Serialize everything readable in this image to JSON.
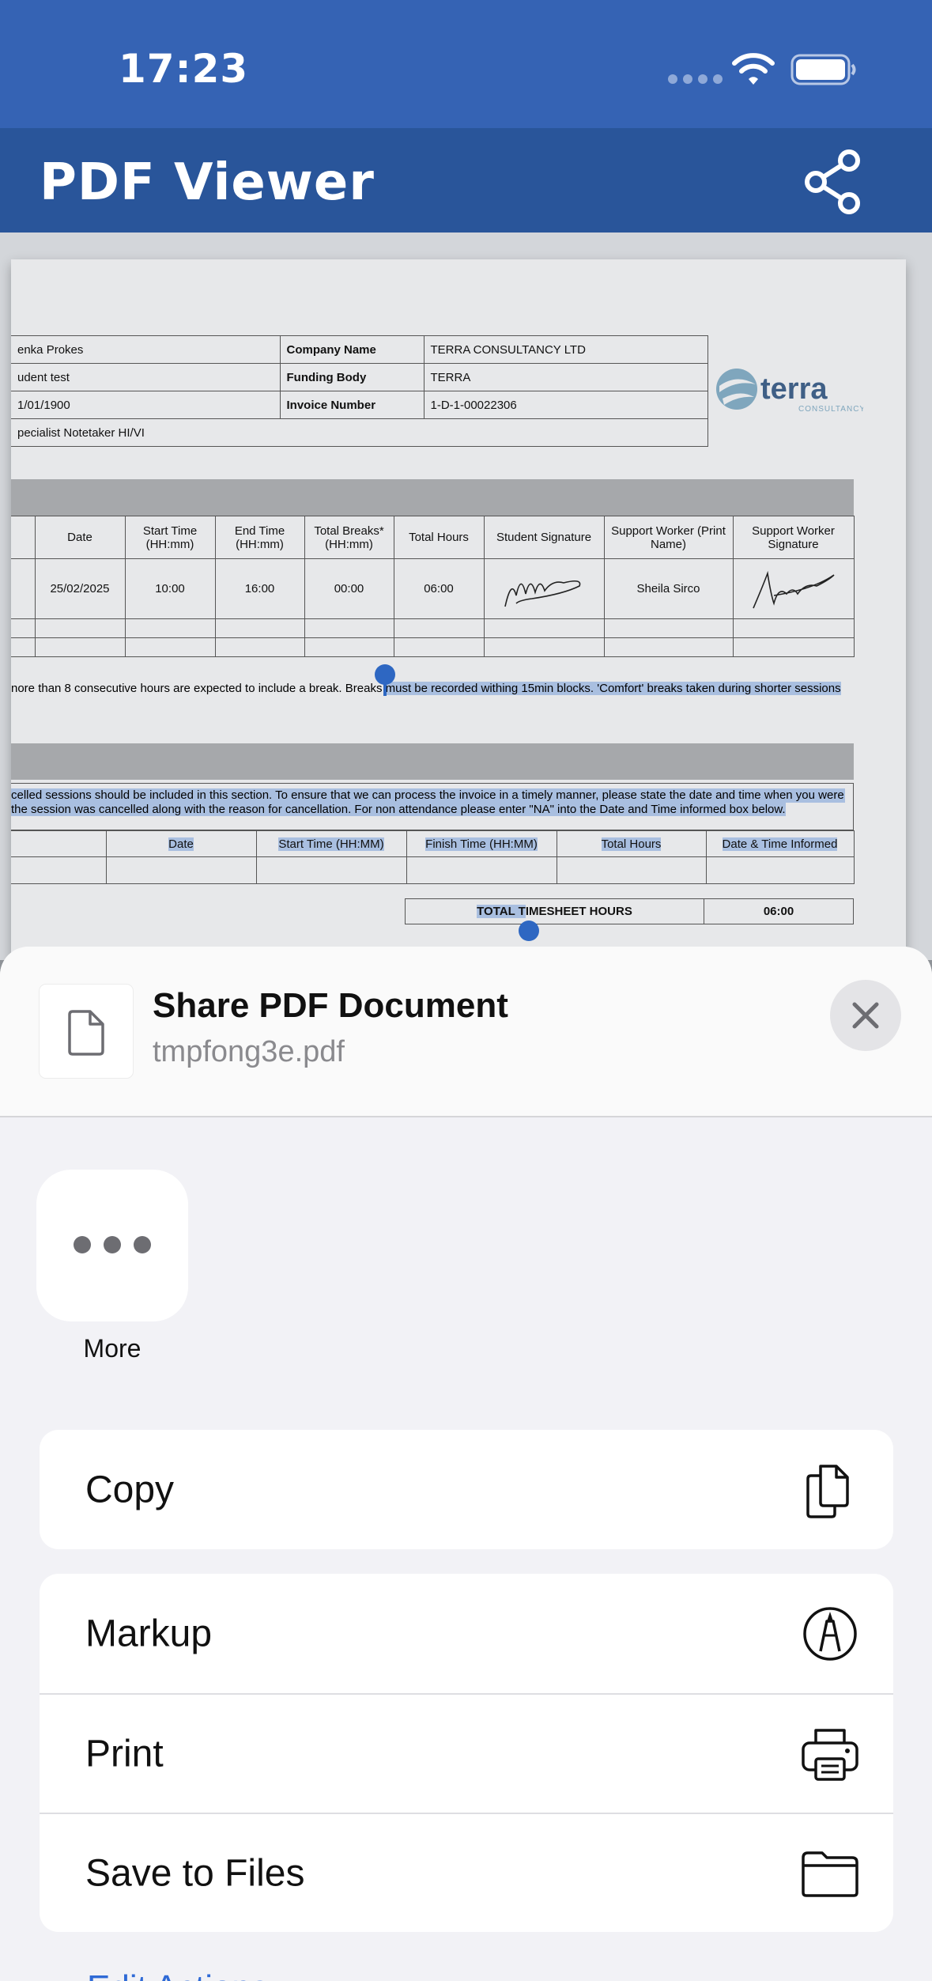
{
  "status_bar": {
    "time": "17:23",
    "wifi_icon": "wifi-icon",
    "battery_icon": "battery-icon"
  },
  "app_bar": {
    "title": "PDF Viewer",
    "share_icon": "share-icon"
  },
  "pdf": {
    "info_rows": [
      {
        "value": "enka Prokes",
        "label": "Company Name",
        "right": "TERRA CONSULTANCY LTD"
      },
      {
        "value": "udent test",
        "label": "Funding Body",
        "right": "TERRA"
      },
      {
        "value": "1/01/1900",
        "label": "Invoice Number",
        "right": "1-D-1-00022306"
      },
      {
        "value": "pecialist Notetaker HI/VI",
        "label": "",
        "right": ""
      }
    ],
    "logo_text": "terra",
    "logo_subtext": "CONSULTANCY",
    "session_headers": [
      "",
      "Date",
      "Start Time (HH:mm)",
      "End Time (HH:mm)",
      "Total Breaks* (HH:mm)",
      "Total Hours",
      "Student Signature",
      "Support Worker (Print Name)",
      "Support Worker Signature"
    ],
    "session_row": {
      "date": "25/02/2025",
      "start": "10:00",
      "end": "16:00",
      "breaks": "00:00",
      "hours": "06:00",
      "worker_name": "Sheila Sirco"
    },
    "breaks_note_plain": "nore than 8 consecutive hours are expected to include a break. Breaks ",
    "breaks_note_selected": "must be recorded withing 15min blocks. 'Comfort' breaks taken during shorter sessions",
    "cancel_note_line1": "celled sessions should be included in this section. To ensure that we can process the invoice in a timely manner, please state the date and time when you were",
    "cancel_note_line2": "the session was cancelled along with the reason for cancellation. For non attendance please enter \"NA\" into the Date and Time informed box below.",
    "cancel_headers": [
      "",
      "Date",
      "Start Time (HH:MM)",
      "Finish Time (HH:MM)",
      "Total Hours",
      "Date & Time Informed"
    ],
    "total_label_a": "TOTAL T",
    "total_label_b": "IMESHEET HOURS",
    "total_value": "06:00"
  },
  "share_sheet": {
    "title": "Share PDF Document",
    "filename": "tmpfong3e.pdf",
    "doc_icon": "document-icon",
    "close_icon": "close-icon",
    "apps": [
      {
        "label": "More",
        "icon": "more-icon"
      }
    ],
    "actions": [
      {
        "label": "Copy",
        "icon": "copy-icon"
      },
      {
        "label": "Markup",
        "icon": "markup-icon"
      },
      {
        "label": "Print",
        "icon": "printer-icon"
      },
      {
        "label": "Save to Files",
        "icon": "folder-icon"
      }
    ],
    "edit_actions": "Edit Actions..."
  },
  "colors": {
    "status_bar": "#3563b4",
    "app_bar": "#29559a",
    "selection": "#a9bfe0",
    "handle": "#2e67c2",
    "link": "#2f6ad6"
  }
}
